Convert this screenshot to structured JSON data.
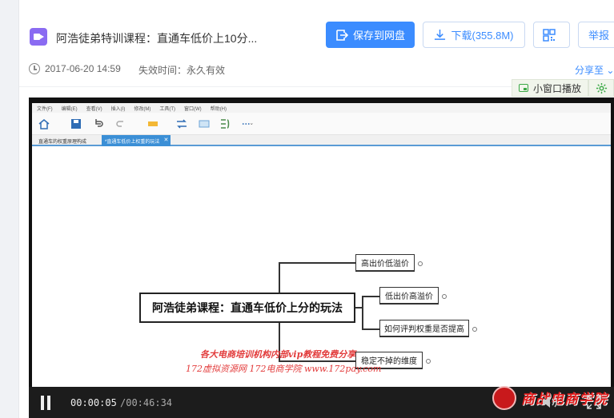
{
  "header": {
    "file_title": "阿浩徒弟特训课程：直通车低价上10分...",
    "save_label": "保存到网盘",
    "download_label": "下载(355.8M)",
    "report_label": "举报",
    "date": "2017-06-20 14:59",
    "expiry": "失效时间：永久有效",
    "share_label": "分享至"
  },
  "player_bar": {
    "mini_player_label": "小窗口播放"
  },
  "video_content": {
    "app_menu": [
      "文件(F)",
      "编辑(E)",
      "查看(V)",
      "插入(I)",
      "修改(M)",
      "工具(T)",
      "窗口(W)",
      "帮助(H)"
    ],
    "tabs": [
      "直通车的权重原理构成",
      "*直通车低价上权重的玩法"
    ],
    "tab_close": "✕",
    "mindmap": {
      "root": "阿浩徒弟课程：直通车低价上分的玩法",
      "children": [
        "高出价低溢价",
        "低出价高溢价",
        "如何评判权重是否提高",
        "稳定不掉的维度"
      ]
    },
    "watermark_line1": "各大电商培训机构内部vip教程免费分享",
    "watermark_line2": "172虚拟资源网 172电商学院 www.172pay.com"
  },
  "controls": {
    "current_time": "00:00:05",
    "total_time": "/00:46:34",
    "brand_text": "商战电商学院"
  },
  "colors": {
    "accent": "#3b8cff",
    "file_icon": "#8a6bf2",
    "mini_icon": "#3aa845",
    "watermark": "#e23b3b"
  }
}
